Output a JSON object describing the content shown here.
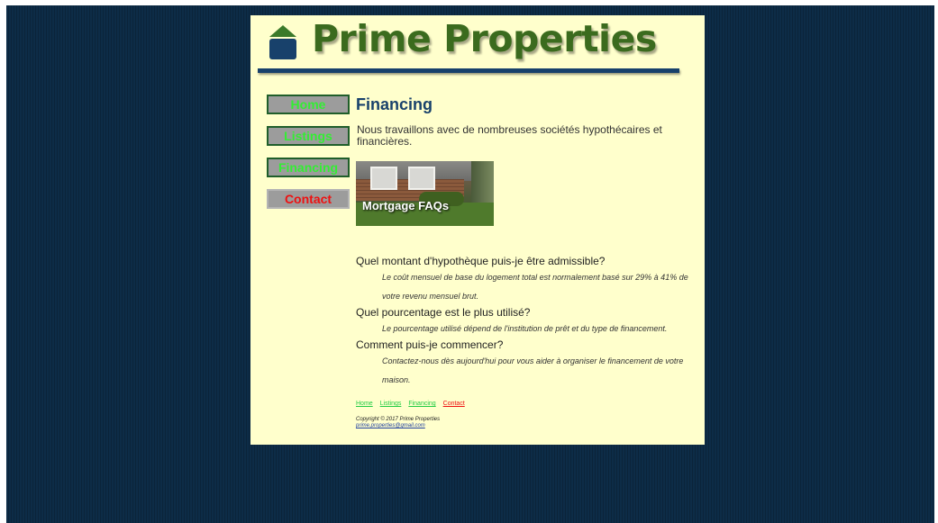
{
  "site": {
    "title": "Prime Properties"
  },
  "nav": [
    {
      "label": "Home"
    },
    {
      "label": "Listings"
    },
    {
      "label": "Financing"
    },
    {
      "label": "Contact"
    }
  ],
  "page": {
    "heading": "Financing",
    "intro": "Nous travaillons avec de nombreuses sociétés hypothécaires et financières.",
    "banner_caption": "Mortgage FAQs"
  },
  "faq": [
    {
      "question": "Quel montant d'hypothèque puis-je être admissible?",
      "answer": "Le coût mensuel de base du logement total est normalement basé sur 29% à 41% de votre revenu mensuel brut."
    },
    {
      "question": "Quel pourcentage est le plus utilisé?",
      "answer": "Le pourcentage utilisé dépend de l'institution de prêt et du type de financement."
    },
    {
      "question": "Comment puis-je commencer?",
      "answer": "Contactez-nous dès aujourd'hui pour vous aider à organiser le financement de votre maison."
    }
  ],
  "footer": {
    "links": [
      {
        "label": "Home"
      },
      {
        "label": "Listings"
      },
      {
        "label": "Financing"
      },
      {
        "label": "Contact"
      }
    ],
    "copyright": "Copyright © 2017 Prime Properties",
    "email": "prime.properties@gmail.com"
  },
  "colors": {
    "page_background": "#0d2c47",
    "content_background": "#ffffcc",
    "title_green": "#3b6b1e",
    "heading_blue": "#18416b",
    "nav_link_green": "#33ee33",
    "nav_contact_red": "#ee1111",
    "nav_button_gray": "#9c9c9c"
  },
  "icons": {
    "logo": "house-icon"
  }
}
